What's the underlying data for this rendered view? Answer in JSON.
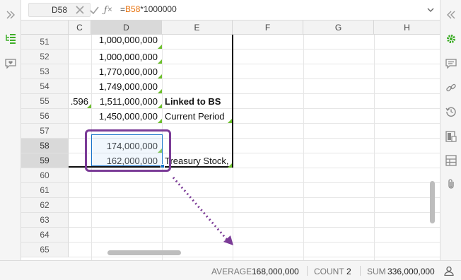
{
  "formula_bar": {
    "name_box": "D58",
    "formula_prefix": "=",
    "formula_ref": "B58",
    "formula_rest": "*1000000"
  },
  "columns": [
    {
      "label": "C",
      "selected": false
    },
    {
      "label": "D",
      "selected": true
    },
    {
      "label": "E",
      "selected": false
    },
    {
      "label": "F",
      "selected": false
    },
    {
      "label": "G",
      "selected": false
    },
    {
      "label": "H",
      "selected": false
    }
  ],
  "rows": [
    {
      "label": "51",
      "selected": false
    },
    {
      "label": "52",
      "selected": false
    },
    {
      "label": "53",
      "selected": false
    },
    {
      "label": "54",
      "selected": false
    },
    {
      "label": "55",
      "selected": false
    },
    {
      "label": "56",
      "selected": false
    },
    {
      "label": "57",
      "selected": false
    },
    {
      "label": "58",
      "selected": true
    },
    {
      "label": "59",
      "selected": true
    },
    {
      "label": "60",
      "selected": false
    },
    {
      "label": "61",
      "selected": false
    },
    {
      "label": "62",
      "selected": false
    },
    {
      "label": "63",
      "selected": false
    },
    {
      "label": "64",
      "selected": false
    },
    {
      "label": "65",
      "selected": false
    }
  ],
  "cells": {
    "c55": ".596",
    "d51": "1,000,000,000",
    "d52": "1,000,000,000",
    "d53": "1,770,000,000",
    "d54": "1,749,000,000",
    "d55": "1,511,000,000",
    "d56": "1,450,000,000",
    "d58": "174,000,000",
    "d59": "162,000,000",
    "e55": "Linked to BS",
    "e56": "Current Period",
    "e59": "Treasury Stock,"
  },
  "status_bar": {
    "average_label": "AVERAGE",
    "average_value": "168,000,000",
    "count_label": "COUNT",
    "count_value": "2",
    "sum_label": "SUM",
    "sum_value": "336,000,000"
  },
  "colors": {
    "accent_green": "#3fae29",
    "selection_blue": "#1a73c9",
    "annotation_purple": "#7b3b97",
    "formula_ref": "#e8730f"
  }
}
